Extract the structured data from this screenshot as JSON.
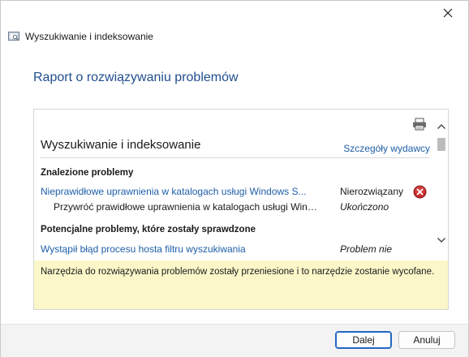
{
  "window": {
    "title": "Wyszukiwanie i indeksowanie",
    "header": "Raport o rozwiązywaniu problemów"
  },
  "report": {
    "title": "Wyszukiwanie i indeksowanie",
    "publisher_link": "Szczegóły wydawcy",
    "found_heading": "Znalezione problemy",
    "found_items": [
      {
        "label": "Nieprawidłowe uprawnienia w katalogach usługi Windows S...",
        "status": "Nierozwiązany",
        "icon": "error-icon"
      },
      {
        "label": "Przywróć prawidłowe uprawnienia w katalogach usługi Wind...",
        "status": "Ukończono"
      }
    ],
    "potential_heading": "Potencjalne problemy, które zostały sprawdzone",
    "potential_items": [
      {
        "label": "Wystąpił błąd procesu hosta filtru wyszukiwania",
        "status": "Problem nie"
      }
    ]
  },
  "notice": {
    "text": "Narzędzia do rozwiązywania problemów zostały przeniesione i to narzędzie zostanie wycofane."
  },
  "buttons": {
    "next": "Dalej",
    "cancel": "Anuluj"
  },
  "colors": {
    "link": "#1f5fa8",
    "header": "#1f4e8c",
    "notice_bg": "#fbf7c9",
    "error": "#c42b2b"
  }
}
